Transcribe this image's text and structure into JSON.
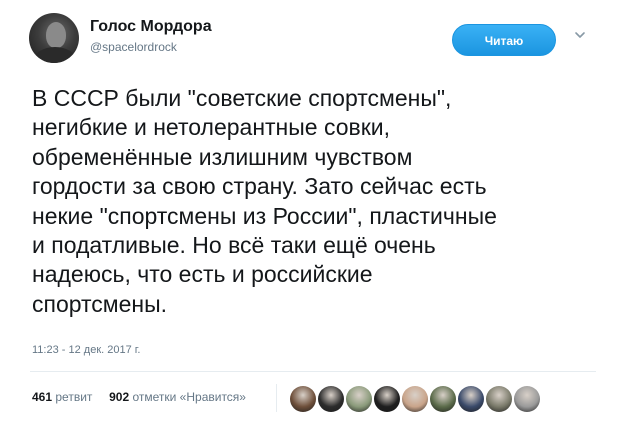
{
  "author": {
    "name": "Голос Мордора",
    "handle": "@spacelordrock"
  },
  "follow_button": {
    "label": "Читаю",
    "color": "#1da1f2"
  },
  "menu_icon": "chevron-down-icon",
  "tweet": {
    "text": "В СССР были \"советские спортсмены\",\nнегибкие и нетолерантные совки,\nобременённые излишним чувством\nгордости за свою страну. Зато сейчас есть\nнекие \"спортсмены из России\", пластичные\nи податливые. Но всё таки ещё очень\nнадеюсь, что есть и российские\nспортсмены.",
    "timestamp": "11:23 - 12 дек. 2017 г."
  },
  "stats": {
    "retweets_count": "461",
    "retweets_label": "ретвит",
    "likes_count": "902",
    "likes_label": "отметки «Нравится»"
  },
  "likers": [
    {
      "name": "liker-avatar-1",
      "color": "#6e4f3a"
    },
    {
      "name": "liker-avatar-2",
      "color": "#2c2c2c"
    },
    {
      "name": "liker-avatar-3",
      "color": "#8a9a7a"
    },
    {
      "name": "liker-avatar-4",
      "color": "#1e1e1e"
    },
    {
      "name": "liker-avatar-5",
      "color": "#c9a48a"
    },
    {
      "name": "liker-avatar-6",
      "color": "#5b6b4a"
    },
    {
      "name": "liker-avatar-7",
      "color": "#3a4a6a"
    },
    {
      "name": "liker-avatar-8",
      "color": "#7a7a6a"
    },
    {
      "name": "liker-avatar-9",
      "color": "#9a9a9a"
    }
  ]
}
